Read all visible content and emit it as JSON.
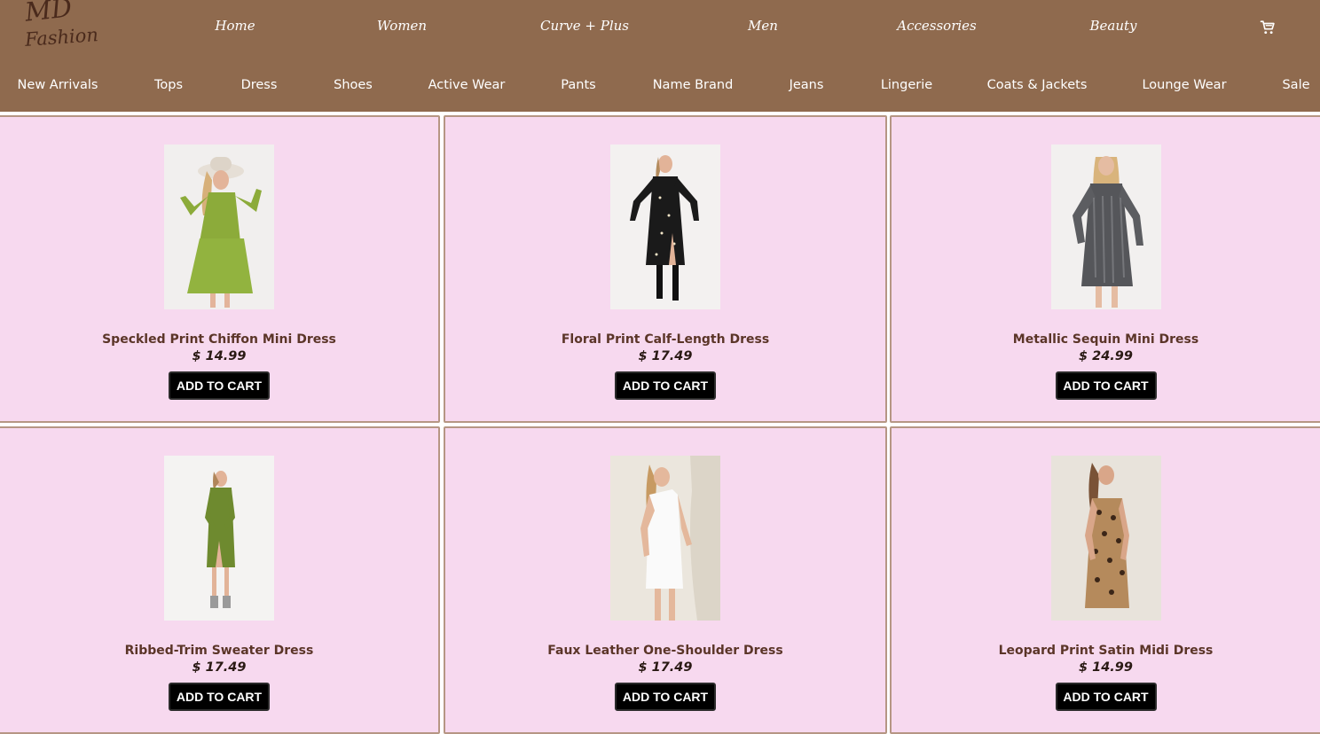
{
  "logo": {
    "line1": "MD",
    "line2": "Fashion"
  },
  "top_nav": [
    "Home",
    "Women",
    "Curve + Plus",
    "Men",
    "Accessories",
    "Beauty"
  ],
  "cart_icon": "cart-icon",
  "sub_nav": [
    "New Arrivals",
    "Tops",
    "Dress",
    "Shoes",
    "Active Wear",
    "Pants",
    "Name Brand",
    "Jeans",
    "Lingerie",
    "Coats & Jackets",
    "Lounge Wear",
    "Sale"
  ],
  "products": [
    {
      "name": "Speckled Print Chiffon Mini Dress",
      "price": "$ 14.99",
      "button": "ADD TO CART"
    },
    {
      "name": "Floral Print Calf-Length Dress",
      "price": "$ 17.49",
      "button": "ADD TO CART"
    },
    {
      "name": "Metallic Sequin Mini Dress",
      "price": "$ 24.99",
      "button": "ADD TO CART"
    },
    {
      "name": "Ribbed-Trim Sweater Dress",
      "price": "$ 17.49",
      "button": "ADD TO CART"
    },
    {
      "name": "Faux Leather One-Shoulder Dress",
      "price": "$ 17.49",
      "button": "ADD TO CART"
    },
    {
      "name": "Leopard Print Satin Midi Dress",
      "price": "$ 14.99",
      "button": "ADD TO CART"
    }
  ],
  "colors": {
    "header": "#8f6a4e",
    "card": "#f7d9ef",
    "button": "#000000"
  }
}
